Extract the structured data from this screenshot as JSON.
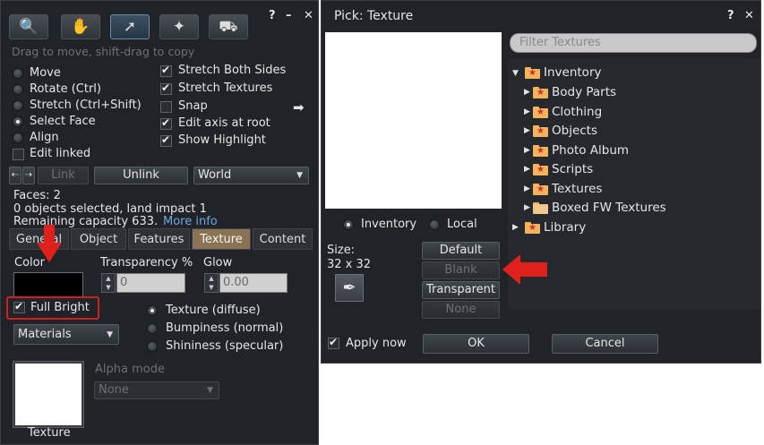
{
  "build": {
    "title_icons": [
      "?",
      "–",
      "✕"
    ],
    "hint": "Drag to move, shift-drag to copy",
    "modes": [
      "Move",
      "Rotate (Ctrl)",
      "Stretch (Ctrl+Shift)",
      "Select Face",
      "Align"
    ],
    "selected_mode": "Select Face",
    "edit_linked": "Edit linked",
    "options": [
      "Stretch Both Sides",
      "Stretch Textures",
      "Snap",
      "Edit axis at root",
      "Show Highlight"
    ],
    "link": "Link",
    "unlink": "Unlink",
    "world": "World",
    "faces": "Faces: 2",
    "selected_info": "0 objects selected, land impact 1",
    "remaining": "Remaining capacity 633.",
    "more_info": "More info",
    "tabs": [
      "General",
      "Object",
      "Features",
      "Texture",
      "Content"
    ],
    "active_tab": "Texture",
    "color_label": "Color",
    "transparency_label": "Transparency %",
    "transparency_value": "0",
    "glow_label": "Glow",
    "glow_value": "0.00",
    "full_bright": "Full Bright",
    "materials": "Materials",
    "map_options": [
      "Texture (diffuse)",
      "Bumpiness (normal)",
      "Shininess (specular)"
    ],
    "alpha_mode_label": "Alpha mode",
    "alpha_mode_value": "None",
    "texture_label": "Texture"
  },
  "picker": {
    "title": "Pick: Texture",
    "title_icons": [
      "?",
      "✕"
    ],
    "filter_placeholder": "Filter Textures",
    "inventory_radio": "Inventory",
    "local_radio": "Local",
    "size_label": "Size:",
    "size_value": "32 x 32",
    "buttons": [
      "Default",
      "Blank",
      "Transparent",
      "None"
    ],
    "apply_now": "Apply now",
    "ok": "OK",
    "cancel": "Cancel",
    "tree": {
      "root": "Inventory",
      "children": [
        "Body Parts",
        "Clothing",
        "Objects",
        "Photo Album",
        "Scripts",
        "Textures",
        "Boxed FW Textures"
      ],
      "library": "Library"
    }
  },
  "colors": {
    "panel": "#202328",
    "active_tab": "#8a7355",
    "highlight_red": "#e0201c",
    "folder": "#f4b25a"
  }
}
